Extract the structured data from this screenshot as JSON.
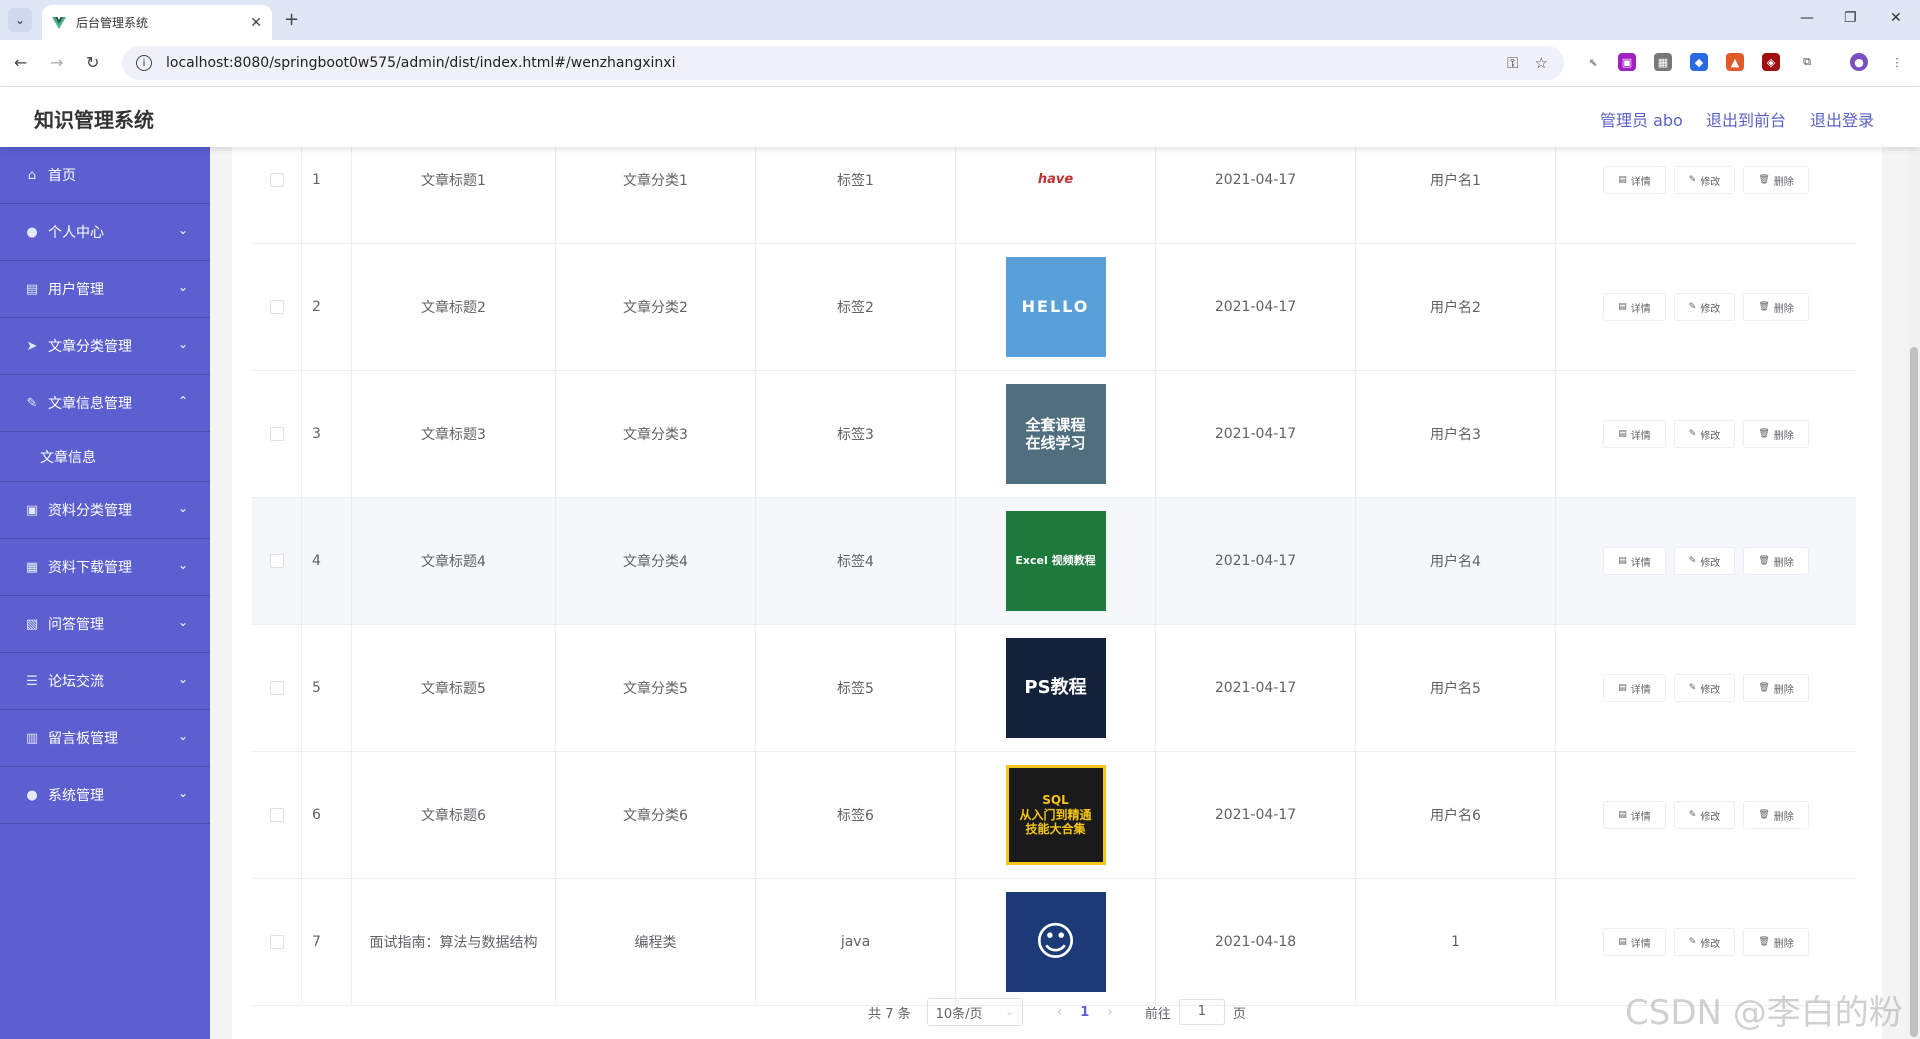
{
  "browser": {
    "tab_title": "后台管理系统",
    "url": "localhost:8080/springboot0w575/admin/dist/index.html#/wenzhangxinxi"
  },
  "header": {
    "app_title": "知识管理系统",
    "admin_label": "管理员 abo",
    "to_front": "退出到前台",
    "logout": "退出登录"
  },
  "sidebar": {
    "items": [
      {
        "label": "首页",
        "icon": "home-icon",
        "glyph": "⌂",
        "arrow": ""
      },
      {
        "label": "个人中心",
        "icon": "user-icon",
        "glyph": "●",
        "arrow": "⌄"
      },
      {
        "label": "用户管理",
        "icon": "document-icon",
        "glyph": "▤",
        "arrow": "⌄"
      },
      {
        "label": "文章分类管理",
        "icon": "send-icon",
        "glyph": "➤",
        "arrow": "⌄"
      },
      {
        "label": "文章信息管理",
        "icon": "edit-icon",
        "glyph": "✎",
        "arrow": "⌃"
      },
      {
        "label": "资料分类管理",
        "icon": "suitcase-icon",
        "glyph": "▣",
        "arrow": "⌄"
      },
      {
        "label": "资料下载管理",
        "icon": "grid-icon",
        "glyph": "▦",
        "arrow": "⌄"
      },
      {
        "label": "问答管理",
        "icon": "clipboard-icon",
        "glyph": "▧",
        "arrow": "⌄"
      },
      {
        "label": "论坛交流",
        "icon": "list-icon",
        "glyph": "☰",
        "arrow": "⌄"
      },
      {
        "label": "留言板管理",
        "icon": "chart-icon",
        "glyph": "▥",
        "arrow": "⌄"
      },
      {
        "label": "系统管理",
        "icon": "person-icon",
        "glyph": "●",
        "arrow": "⌄"
      }
    ],
    "submenu_label": "文章信息"
  },
  "table": {
    "rows": [
      {
        "index": "1",
        "title": "文章标题1",
        "category": "文章分类1",
        "tag": "标签1",
        "date": "2021-04-17",
        "user": "用户名1",
        "thumb": "have"
      },
      {
        "index": "2",
        "title": "文章标题2",
        "category": "文章分类2",
        "tag": "标签2",
        "date": "2021-04-17",
        "user": "用户名2",
        "thumb": "HELLO"
      },
      {
        "index": "3",
        "title": "文章标题3",
        "category": "文章分类3",
        "tag": "标签3",
        "date": "2021-04-17",
        "user": "用户名3",
        "thumb": "全套课程\n在线学习"
      },
      {
        "index": "4",
        "title": "文章标题4",
        "category": "文章分类4",
        "tag": "标签4",
        "date": "2021-04-17",
        "user": "用户名4",
        "thumb": "Excel 视频教程"
      },
      {
        "index": "5",
        "title": "文章标题5",
        "category": "文章分类5",
        "tag": "标签5",
        "date": "2021-04-17",
        "user": "用户名5",
        "thumb": "PS教程"
      },
      {
        "index": "6",
        "title": "文章标题6",
        "category": "文章分类6",
        "tag": "标签6",
        "date": "2021-04-17",
        "user": "用户名6",
        "thumb": "SQL\n从入门到精通\n技能大合集"
      },
      {
        "index": "7",
        "title": "面试指南：算法与数据结构",
        "category": "编程类",
        "tag": "java",
        "date": "2021-04-18",
        "user": "1",
        "thumb": ""
      }
    ],
    "ops": {
      "detail": "详情",
      "edit": "修改",
      "delete": "删除"
    }
  },
  "pager": {
    "total": "共 7 条",
    "page_size": "10条/页",
    "current_page": "1",
    "goto_label": "前往",
    "goto_value": "1",
    "page_suffix": "页"
  },
  "watermark": "CSDN @李白的粉",
  "colors": {
    "sidebar": "#5b5fcf",
    "accent": "#5a62c7"
  }
}
